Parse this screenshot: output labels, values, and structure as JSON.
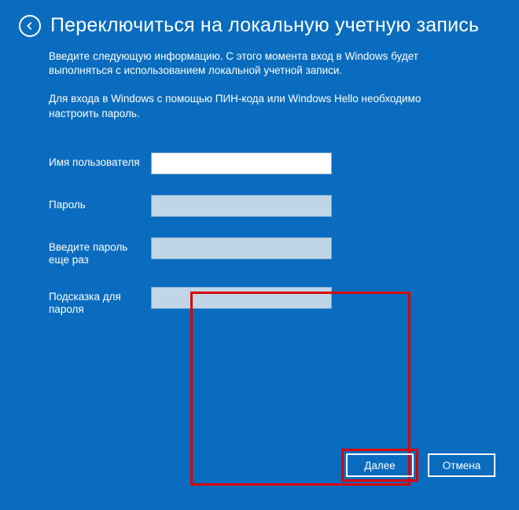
{
  "header": {
    "title": "Переключиться на локальную учетную запись"
  },
  "intro": "Введите следующую информацию. С этого момента вход в Windows будет выполняться с использованием локальной учетной записи.",
  "pin_note": "Для входа в Windows с помощью ПИН-кода или Windows Hello необходимо настроить пароль.",
  "fields": {
    "username": {
      "label": "Имя пользователя",
      "value": ""
    },
    "password": {
      "label": "Пароль",
      "value": ""
    },
    "confirm": {
      "label": "Введите пароль еще раз",
      "value": ""
    },
    "hint": {
      "label": "Подсказка для пароля",
      "value": ""
    }
  },
  "buttons": {
    "next": "Далее",
    "cancel": "Отмена"
  }
}
